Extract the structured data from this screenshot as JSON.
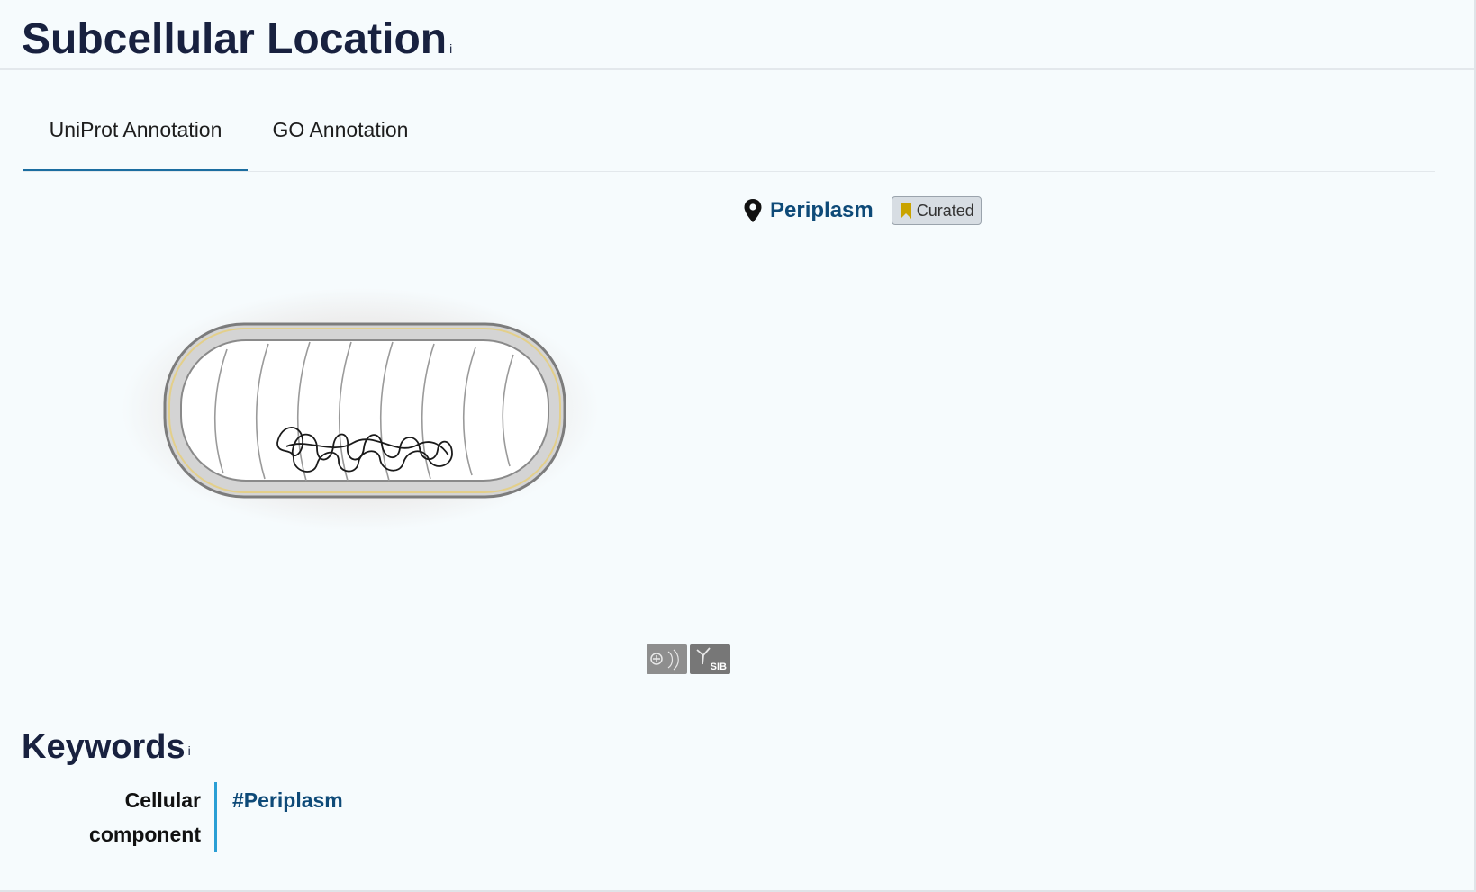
{
  "subcellular": {
    "title": "Subcellular Location",
    "info_marker": "i",
    "tabs": [
      {
        "label": "UniProt Annotation",
        "active": true
      },
      {
        "label": "GO Annotation",
        "active": false
      }
    ],
    "location": {
      "name": "Periplasm",
      "badge": "Curated",
      "icon": "map-pin-icon"
    },
    "logos": {
      "second_label": "SIB"
    }
  },
  "keywords": {
    "title": "Keywords",
    "info_marker": "i",
    "category": "Cellular component",
    "keyword": "#Periplasm"
  },
  "colors": {
    "background": "#f6fbfd",
    "heading": "#18213f",
    "link": "#0e4a78",
    "tab_underline": "#1b6da0",
    "keyword_bar": "#2b9fd5",
    "badge_icon": "#c9a300"
  }
}
